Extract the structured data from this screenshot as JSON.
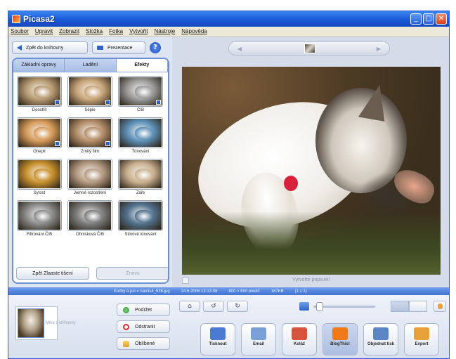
{
  "window": {
    "title": "Picasa2",
    "buttons": {
      "minimize": "_",
      "maximize": "□",
      "close": "✕"
    }
  },
  "menu": [
    "Soubor",
    "Upravit",
    "Zobrazit",
    "Složka",
    "Fotka",
    "Vytvořit",
    "Nástroje",
    "Nápověda"
  ],
  "left": {
    "back_label": "Zpět do knihovny",
    "presentation_label": "Prezentace",
    "help_label": "?",
    "tabs": [
      "Základní opravy",
      "Ladění",
      "Efekty"
    ],
    "effects": [
      {
        "label": "Doostřit",
        "tint": "#b79a72"
      },
      {
        "label": "Sépie",
        "tint": "#c9a57a"
      },
      {
        "label": "Č/B",
        "tint": "#9a9a9a"
      },
      {
        "label": "Ohepit",
        "tint": "#d59a5a"
      },
      {
        "label": "Zrnitý film",
        "tint": "#b48e6a"
      },
      {
        "label": "Tónování",
        "tint": "#5d90b8"
      },
      {
        "label": "Sytost",
        "tint": "#c8912f"
      },
      {
        "label": "Jemné rozostření",
        "tint": "#b59a82"
      },
      {
        "label": "Záře",
        "tint": "#c9b08f"
      },
      {
        "label": "Filtrování Č/B",
        "tint": "#8c8c8c"
      },
      {
        "label": "Ohnisková Č/B",
        "tint": "#7d7d7d"
      },
      {
        "label": "Stínové tónování",
        "tint": "#52728e"
      }
    ],
    "undo_label": "Zpět Zlaaste tišení",
    "redo_label": "Znovu"
  },
  "viewer": {
    "caption_placeholder": "Vytvořte popisek!",
    "status": [
      "Kočky a psi » narcis4_536.jpg",
      "24.6.2006 13:13:08",
      "800 × 600 pixelů",
      "187KB",
      "(1 z 1)"
    ]
  },
  "bottom": {
    "tray_label": "Mika z knihovny",
    "actions": [
      "Podržet",
      "Odstranit",
      "Oblíbené"
    ],
    "tools": [
      "⌂",
      "↺",
      "↻"
    ],
    "big_buttons": [
      {
        "label": "Tisknout",
        "color": "#4a7bd0"
      },
      {
        "label": "Email",
        "color": "#7aa0d8"
      },
      {
        "label": "Koláž",
        "color": "#d8533c"
      },
      {
        "label": "BlogThis!",
        "color": "#f07a1a"
      },
      {
        "label": "Objednat tisk",
        "color": "#5a86c8"
      },
      {
        "label": "Export",
        "color": "#e7a23a"
      }
    ]
  }
}
